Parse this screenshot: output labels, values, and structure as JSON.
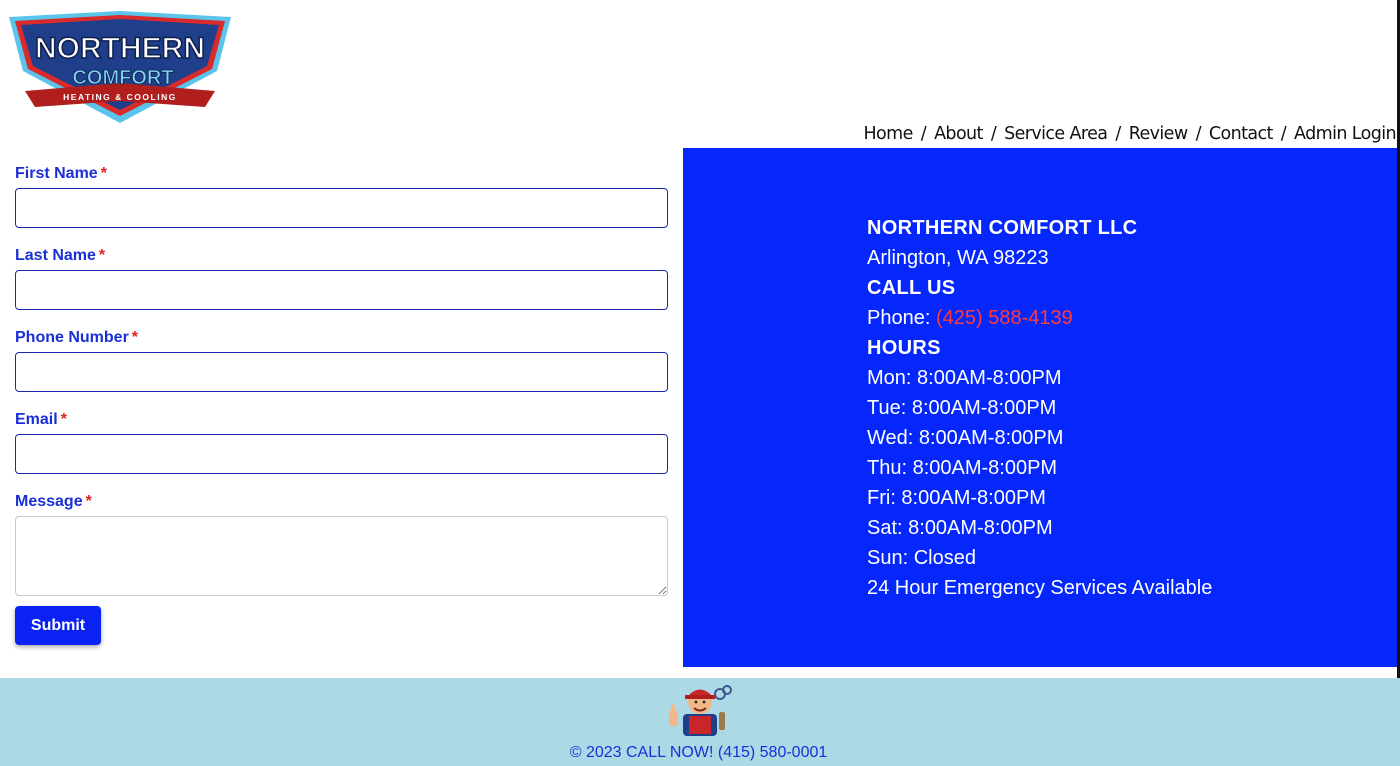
{
  "logo": {
    "line1": "NORTHERN",
    "line2": "COMFORT",
    "line3": "HEATING & COOLING"
  },
  "nav": {
    "items": [
      "Home",
      "About",
      "Service Area",
      "Review",
      "Contact",
      "Admin Login"
    ],
    "separator": "/"
  },
  "form": {
    "first_name_label": "First Name",
    "last_name_label": "Last Name",
    "phone_label": "Phone Number",
    "email_label": "Email",
    "message_label": "Message",
    "required_mark": "*",
    "first_name_value": "",
    "last_name_value": "",
    "phone_value": "",
    "email_value": "",
    "message_value": "",
    "submit_label": "Submit"
  },
  "info": {
    "company": "NORTHERN COMFORT LLC",
    "address": "Arlington, WA 98223",
    "call_heading": "CALL US",
    "phone_prefix": "Phone:",
    "phone_number": "(425) 588-4139",
    "hours_heading": "HOURS",
    "hours": [
      "Mon: 8:00AM-8:00PM",
      "Tue: 8:00AM-8:00PM",
      "Wed: 8:00AM-8:00PM",
      "Thu: 8:00AM-8:00PM",
      "Fri: 8:00AM-8:00PM",
      "Sat: 8:00AM-8:00PM",
      "Sun: Closed"
    ],
    "emergency": "24 Hour Emergency Services Available"
  },
  "footer": {
    "copyright": "© 2023 CALL NOW! (415) 580-0001"
  },
  "colors": {
    "accent_blue": "#0527fc",
    "label_blue": "#1a2fd6",
    "required_red": "#e02020",
    "phone_red": "#ff3b3b",
    "footer_bg": "#add8e6"
  },
  "icons": {
    "logo": "northern-comfort-logo",
    "mascot": "technician-mascot"
  }
}
